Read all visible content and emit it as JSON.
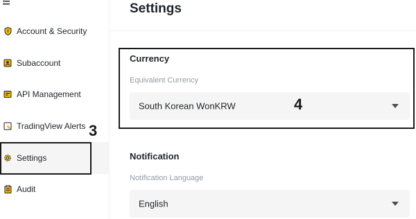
{
  "sidebar": {
    "menu_icon": "menu-collapse-icon",
    "items": [
      {
        "label": "Account & Security",
        "icon": "shield-icon"
      },
      {
        "label": "Subaccount",
        "icon": "subaccount-icon"
      },
      {
        "label": "API Management",
        "icon": "api-icon"
      },
      {
        "label": "TradingView Alerts",
        "icon": "alert-icon"
      },
      {
        "label": "Settings",
        "icon": "gear-icon"
      },
      {
        "label": "Audit",
        "icon": "clipboard-icon"
      }
    ],
    "active_index": 4
  },
  "main": {
    "title": "Settings",
    "currency": {
      "section_title": "Currency",
      "field_label": "Equivalent Currency",
      "selected_value": "South Korean WonKRW"
    },
    "notification": {
      "section_title": "Notification",
      "field_label": "Notification Language",
      "selected_value": "English"
    }
  },
  "annotations": {
    "step_3": "3",
    "step_4": "4"
  },
  "colors": {
    "accent": "#f0b90b",
    "text": "#1e2329",
    "muted": "#929aa5",
    "select_bg": "#f5f5f5",
    "annotation": "#1a1a1a"
  }
}
